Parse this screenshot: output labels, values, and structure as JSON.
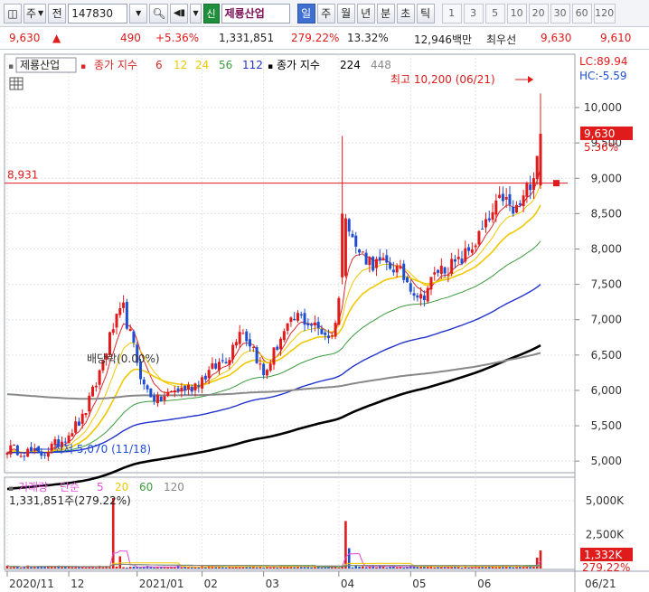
{
  "toolbar": {
    "market": "주",
    "code_type": "전",
    "code": "147830",
    "stock_name": "제룡산업",
    "badge": "신",
    "periods": [
      "일",
      "주",
      "월",
      "년",
      "분",
      "초",
      "틱"
    ],
    "active_period": "일",
    "intervals": [
      "1",
      "3",
      "5",
      "10",
      "20",
      "30",
      "60",
      "120"
    ]
  },
  "info": {
    "price": "9,630",
    "change_arrow": "▲",
    "change": "490",
    "change_pct": "+5.36%",
    "volume": "1,331,851",
    "volume_ratio": "279.22%",
    "turnover": "13.32%",
    "amount": "12,946백만",
    "order_label": "최우선",
    "ask": "9,630",
    "bid": "9,610"
  },
  "legend": {
    "stock_name": "제룡산업",
    "ma_label": "종가 지수",
    "ma_periods": [
      "6",
      "12",
      "24",
      "56",
      "112"
    ],
    "ma_colors": [
      "#d62a2a",
      "#f0c800",
      "#f0c800",
      "#3c9b3c",
      "#2233cc"
    ],
    "ma2_label": "종가 지수",
    "ma2_periods": [
      "224",
      "448"
    ],
    "ma2_colors": [
      "#000000",
      "#888888"
    ]
  },
  "volume_legend": {
    "label": "거래량",
    "ma_label": "단순",
    "ma_periods": [
      "5",
      "20",
      "60",
      "120"
    ],
    "ma_colors": [
      "#e34ad8",
      "#f0c800",
      "#3c9b3c",
      "#888888"
    ],
    "current": "1,331,851주(279.22%)"
  },
  "annotations": {
    "high": "최고 10,200 (06/21)",
    "low": "최저 5,070 (11/18)",
    "dividend": "배당락(0.00%)",
    "lc": "LC:89.94",
    "hc": "HC:-5.59",
    "hline_value": "8,931",
    "price_tag": "9,630",
    "pct_tag": "5.36%",
    "vol_tag": "1,332K",
    "vol_pct_tag": "279.22%"
  },
  "colors": {
    "up": "#e01b1b",
    "down": "#1f4fd1",
    "hline": "#e01b1b"
  },
  "chart_data": {
    "type": "candlestick",
    "price_axis": {
      "ticks": [
        "10,000",
        "9,500",
        "9,000",
        "8,500",
        "8,000",
        "7,500",
        "7,000",
        "6,500",
        "6,000",
        "5,500",
        "5,000"
      ],
      "range": [
        4900,
        10550
      ]
    },
    "volume_axis": {
      "ticks": [
        "5,000K",
        "2,500K"
      ],
      "range": [
        0,
        6200000
      ]
    },
    "x_labels": [
      "2020/11",
      "12",
      "2021/01",
      "02",
      "03",
      "04",
      "05",
      "06",
      "06/21"
    ],
    "x_label_index": [
      0,
      18,
      38,
      57,
      75,
      97,
      118,
      137,
      156
    ],
    "n_bars": 157,
    "close_anchors": [
      [
        0,
        5180
      ],
      [
        10,
        5100
      ],
      [
        16,
        5300
      ],
      [
        22,
        5600
      ],
      [
        26,
        6100
      ],
      [
        31,
        6900
      ],
      [
        34,
        7150
      ],
      [
        37,
        6600
      ],
      [
        40,
        6050
      ],
      [
        44,
        5850
      ],
      [
        49,
        6000
      ],
      [
        54,
        6050
      ],
      [
        60,
        6300
      ],
      [
        65,
        6500
      ],
      [
        68,
        6900
      ],
      [
        72,
        6600
      ],
      [
        75,
        6200
      ],
      [
        80,
        6750
      ],
      [
        85,
        7050
      ],
      [
        90,
        6900
      ],
      [
        95,
        6750
      ],
      [
        98,
        7600
      ],
      [
        99,
        8550
      ],
      [
        102,
        8000
      ],
      [
        107,
        7800
      ],
      [
        113,
        7750
      ],
      [
        117,
        7550
      ],
      [
        121,
        7300
      ],
      [
        126,
        7700
      ],
      [
        132,
        7800
      ],
      [
        137,
        8100
      ],
      [
        141,
        8400
      ],
      [
        145,
        8750
      ],
      [
        148,
        8500
      ],
      [
        151,
        8700
      ],
      [
        154,
        9100
      ],
      [
        156,
        9630
      ]
    ],
    "special_bars": [
      {
        "index": 98,
        "open": 7600,
        "close": 8500,
        "high": 9600,
        "low": 7500
      },
      {
        "index": 156,
        "open": 8900,
        "close": 9630,
        "high": 10200,
        "low": 8850
      }
    ],
    "volume_spikes": [
      [
        31,
        5200000
      ],
      [
        99,
        3500000
      ],
      [
        100,
        1500000
      ],
      [
        33,
        900000
      ],
      [
        155,
        800000
      ],
      [
        156,
        1331851
      ]
    ],
    "ma_periods": [
      6,
      12,
      24,
      56,
      112,
      224,
      448
    ],
    "hline": 8931
  }
}
